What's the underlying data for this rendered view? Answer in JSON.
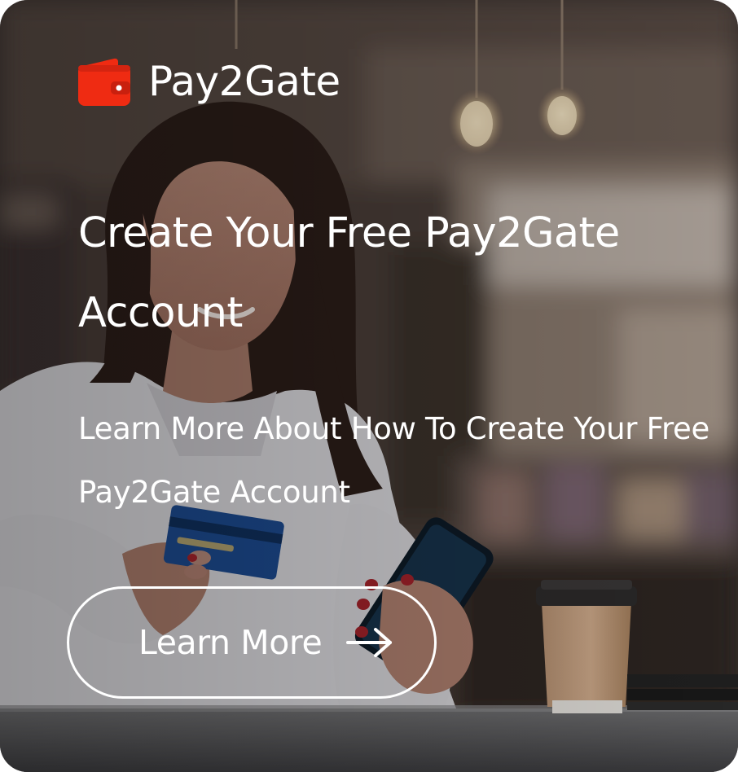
{
  "brand": {
    "name": "Pay2Gate",
    "icon": "wallet-icon",
    "icon_color": "#ef2b12"
  },
  "hero": {
    "headline": "Create Your Free Pay2Gate Account",
    "subtext": "Learn More About How To Create Your Free Pay2Gate Account"
  },
  "cta": {
    "label": "Learn More",
    "icon": "arrow-right-icon"
  },
  "colors": {
    "text": "#ffffff",
    "accent": "#ef2b12"
  }
}
